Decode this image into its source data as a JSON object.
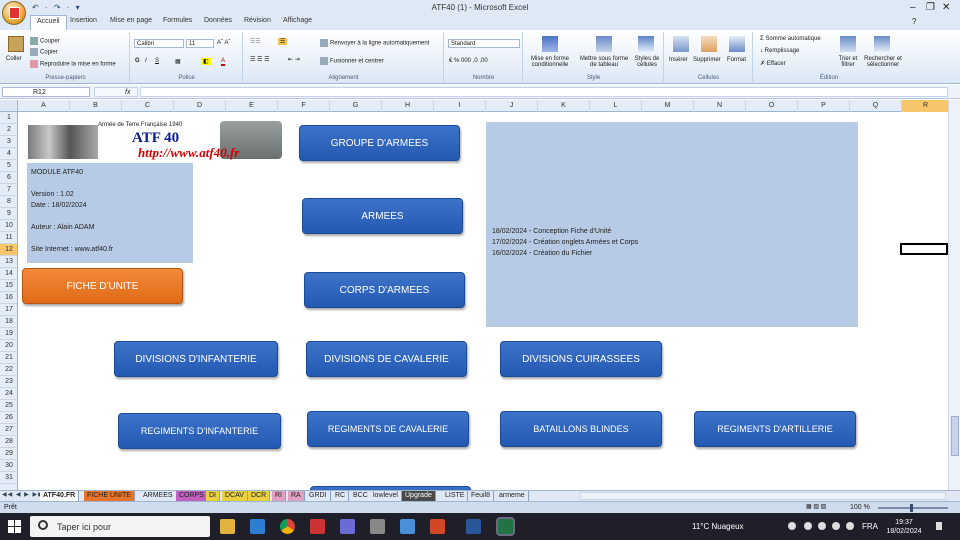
{
  "window": {
    "title": "ATF40 (1) - Microsoft Excel",
    "qat": "↶ · ↷ · ▾"
  },
  "ribbon": {
    "tabs": [
      "Accueil",
      "Insertion",
      "Mise en page",
      "Formules",
      "Données",
      "Révision",
      "Affichage"
    ],
    "clipboard": {
      "paste": "Coller",
      "cut": "Couper",
      "copy": "Copier",
      "format_painter": "Reproduire la mise en forme",
      "label": "Presse-papiers"
    },
    "font": {
      "name": "Calibri",
      "size": "11",
      "label": "Police"
    },
    "alignment": {
      "wrap": "Renvoyer à la ligne automatiquement",
      "merge": "Fusionner et centrer",
      "label": "Alignement"
    },
    "number": {
      "format": "Standard",
      "label": "Nombre"
    },
    "styles": {
      "cond": "Mise en forme conditionnelle",
      "table": "Mettre sous forme de tableau",
      "cell": "Styles de cellules",
      "label": "Style"
    },
    "cells": {
      "insert": "Insérer",
      "delete": "Supprimer",
      "format": "Format",
      "label": "Cellules"
    },
    "editing": {
      "autosum": "Somme automatique",
      "fill": "Remplissage",
      "clear": "Effacer",
      "sort": "Trier et filtrer",
      "find": "Rechercher et sélectionner",
      "label": "Édition"
    }
  },
  "formula_bar": {
    "name_box": "R12",
    "fx": "fx",
    "value": ""
  },
  "grid": {
    "columns": [
      "A",
      "B",
      "C",
      "D",
      "E",
      "F",
      "G",
      "H",
      "I",
      "J",
      "K",
      "L",
      "M",
      "N",
      "O",
      "P",
      "Q",
      "R"
    ],
    "selected_col": "R",
    "rows": [
      "1",
      "2",
      "3",
      "4",
      "5",
      "6",
      "7",
      "8",
      "9",
      "10",
      "11",
      "12",
      "13",
      "14",
      "15",
      "16",
      "17",
      "18",
      "19",
      "20",
      "21",
      "22",
      "23",
      "24",
      "25",
      "26",
      "27",
      "28",
      "29",
      "30",
      "31"
    ],
    "selected_row": "12"
  },
  "banner": {
    "subtitle": "Armée de Terre Française 1940",
    "title": "ATF 40",
    "url": "http://www.atf40.fr"
  },
  "info": {
    "module": "MODULE ATF40",
    "version": "Version : 1.02",
    "date": "Date : 18/02/2024",
    "author": "Auteur : Alain ADAM",
    "site": "Site Internet : www.atf40.fr"
  },
  "changelog": [
    "18/02/2024 - Conception Fiche d'Unité",
    "17/02/2024 - Création onglets Armées et Corps",
    "16/02/2024 - Création du Fichier"
  ],
  "buttons": {
    "fiche_unite": "FICHE D'UNITE",
    "groupe_armees": "GROUPE D'ARMEES",
    "armees": "ARMEES",
    "corps_armees": "CORPS D'ARMEES",
    "div_infanterie": "DIVISIONS D'INFANTERIE",
    "div_cavalerie": "DIVISIONS DE CAVALERIE",
    "div_cuirassees": "DIVISIONS CUIRASSEES",
    "reg_infanterie": "REGIMENTS D'INFANTERIE",
    "reg_cavalerie": "REGIMENTS DE CAVALERIE",
    "bat_blindes": "BATAILLONS BLINDES",
    "reg_artillerie": "REGIMENTS D'ARTILLERIE"
  },
  "sheet_tabs": [
    {
      "label": "ATF40.FR",
      "color": "#ffffff"
    },
    {
      "label": "FICHE UNITE",
      "color": "#e8742a"
    },
    {
      "label": "ARMEES",
      "color": "#dfe8f4"
    },
    {
      "label": "CORPS",
      "color": "#c060c0"
    },
    {
      "label": "DI",
      "color": "#e8d040"
    },
    {
      "label": "DCAV",
      "color": "#e8d040"
    },
    {
      "label": "DCR",
      "color": "#e8d040"
    },
    {
      "label": "RI",
      "color": "#e0a0c0"
    },
    {
      "label": "RA",
      "color": "#e0a0c0"
    },
    {
      "label": "GRDI",
      "color": "#dfe8f4"
    },
    {
      "label": "RC",
      "color": "#dfe8f4"
    },
    {
      "label": "BCC",
      "color": "#dfe8f4"
    },
    {
      "label": "lowlevel",
      "color": "#dfe8f4"
    },
    {
      "label": "Upgrade",
      "color": "#4a4a4a"
    },
    {
      "label": "LISTE",
      "color": "#dfe8f4"
    },
    {
      "label": "Feuil8",
      "color": "#dfe8f4"
    },
    {
      "label": "armeme",
      "color": "#dfe8f4"
    }
  ],
  "status": {
    "ready": "Prêt",
    "zoom": "100 %"
  },
  "taskbar": {
    "search_placeholder": "Taper ici pour",
    "weather": "11°C Nuageux",
    "lang": "FRA",
    "time": "19:37",
    "date": "18/02/2024"
  },
  "colors": {
    "accent": "#2459b2",
    "orange": "#e06a16",
    "panel": "#b8cbe6"
  }
}
